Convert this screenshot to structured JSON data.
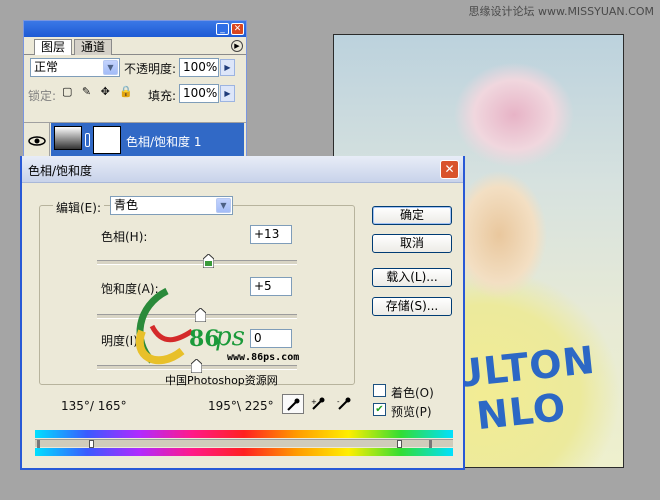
{
  "watermark_top": "思缘设计论坛 www.MISSYUAN.COM",
  "layers_panel": {
    "tabs": [
      "图层",
      "通道"
    ],
    "blend_mode": "正常",
    "opacity_label": "不透明度:",
    "opacity_value": "100%",
    "lock_label": "锁定:",
    "fill_label": "填充:",
    "fill_value": "100%",
    "layer_name": "色相/饱和度 1"
  },
  "dialog": {
    "title": "色相/饱和度",
    "edit_label": "编辑(E):",
    "edit_value": "青色",
    "hue_label": "色相(H):",
    "hue_value": "+13",
    "saturation_label": "饱和度(A):",
    "saturation_value": "+5",
    "lightness_label": "明度(I):",
    "lightness_value": "0",
    "ok_label": "确定",
    "cancel_label": "取消",
    "load_label": "载入(L)...",
    "save_label": "存储(S)...",
    "colorize_label": "着色(O)",
    "colorize_checked": false,
    "preview_label": "预览(P)",
    "preview_checked": true,
    "range_left": "135°/ 165°",
    "range_right": "195°\\ 225°"
  },
  "watermark": {
    "brand": "86",
    "url": "www.86ps.com",
    "site_name": "中国Photoshop资源网"
  },
  "photo": {
    "shirt_text_line1": "ULTON",
    "shirt_text_line2": "NLO"
  }
}
